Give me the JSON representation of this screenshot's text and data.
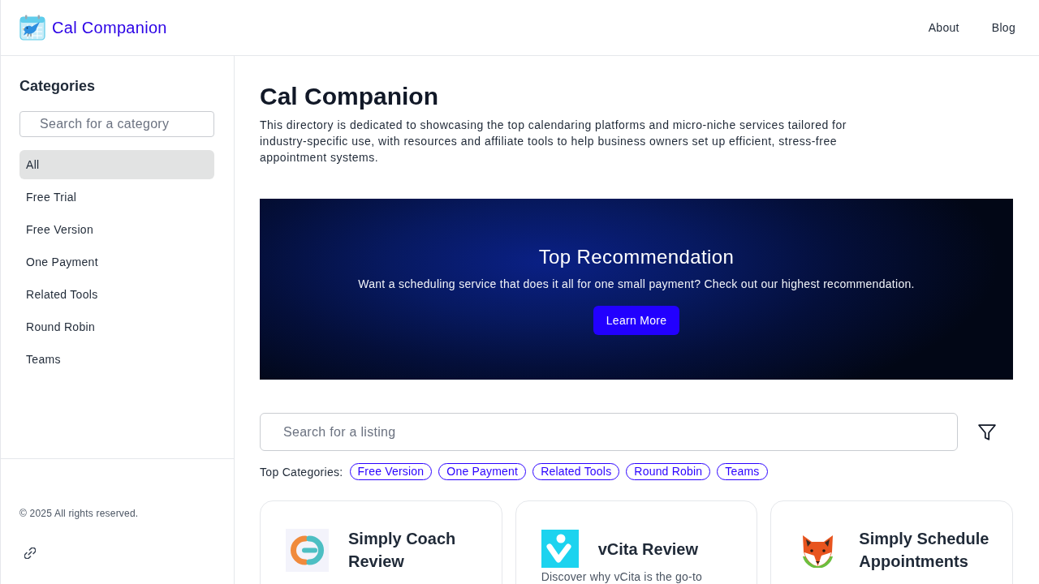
{
  "header": {
    "logo_text": "Cal Companion",
    "nav": [
      {
        "label": "About"
      },
      {
        "label": "Blog"
      }
    ]
  },
  "sidebar": {
    "title": "Categories",
    "search": {
      "placeholder": "Search for a category"
    },
    "items": [
      {
        "label": "All",
        "selected": true
      },
      {
        "label": "Free Trial",
        "selected": false
      },
      {
        "label": "Free Version",
        "selected": false
      },
      {
        "label": "One Payment",
        "selected": false
      },
      {
        "label": "Related Tools",
        "selected": false
      },
      {
        "label": "Round Robin",
        "selected": false
      },
      {
        "label": "Teams",
        "selected": false
      }
    ],
    "footer": {
      "copyright": "© 2025 All rights reserved."
    }
  },
  "main": {
    "title": "Cal Companion",
    "description": "This directory is dedicated to showcasing the top calendaring platforms and micro-niche services tailored for industry-specific use, with resources and affiliate tools to help business owners set up efficient, stress-free appointment systems.",
    "banner": {
      "title": "Top Recommendation",
      "text": "Want a scheduling service that does it all for one small payment? Check out our highest recommendation.",
      "button": "Learn More"
    },
    "listing_search": {
      "placeholder": "Search for a listing"
    },
    "top_categories": {
      "label": "Top Categories:",
      "tags": [
        "Free Version",
        "One Payment",
        "Related Tools",
        "Round Robin",
        "Teams"
      ]
    },
    "cards": [
      {
        "kind": "ring",
        "title": "Simply Coach Review"
      },
      {
        "kind": "v",
        "title": "vCita Review",
        "description": "Discover why vCita is the go-to"
      },
      {
        "kind": "fox",
        "title": "Simply Schedule Appointments"
      }
    ]
  }
}
